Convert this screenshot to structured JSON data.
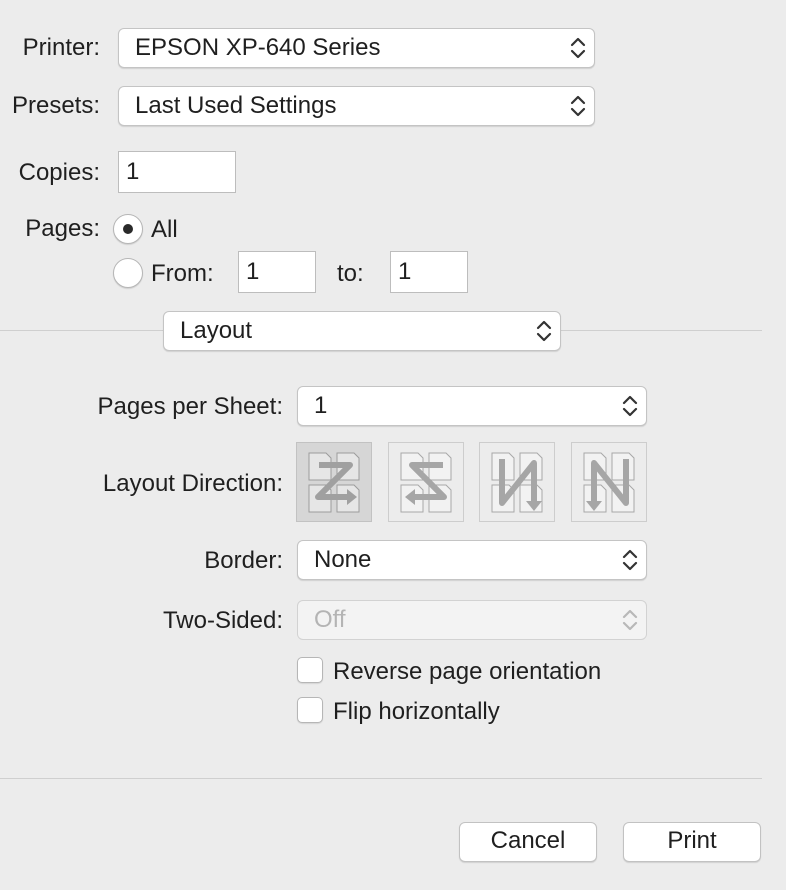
{
  "printer": {
    "label": "Printer:",
    "value": "EPSON XP-640 Series"
  },
  "presets": {
    "label": "Presets:",
    "value": "Last Used Settings"
  },
  "copies": {
    "label": "Copies:",
    "value": "1"
  },
  "pages": {
    "label": "Pages:",
    "all_label": "All",
    "all_selected": true,
    "from_label": "From:",
    "from_value": "1",
    "to_label": "to:",
    "to_value": "1"
  },
  "section_popup": {
    "value": "Layout"
  },
  "layout": {
    "pages_per_sheet": {
      "label": "Pages per Sheet:",
      "value": "1"
    },
    "layout_direction": {
      "label": "Layout Direction:",
      "options": [
        "z-left-right-down-icon",
        "s-right-left-down-icon",
        "n-reverse-top-bottom-icon",
        "n-top-bottom-icon"
      ],
      "selected_index": 0
    },
    "border": {
      "label": "Border:",
      "value": "None"
    },
    "two_sided": {
      "label": "Two-Sided:",
      "value": "Off",
      "enabled": false
    },
    "reverse_orientation": {
      "label": "Reverse page orientation",
      "checked": false
    },
    "flip_horizontally": {
      "label": "Flip horizontally",
      "checked": false
    }
  },
  "buttons": {
    "cancel": "Cancel",
    "print": "Print"
  },
  "colors": {
    "background": "#ececec",
    "separator": "#cfcfcf",
    "arrow_gray": "#a0a0a0"
  }
}
